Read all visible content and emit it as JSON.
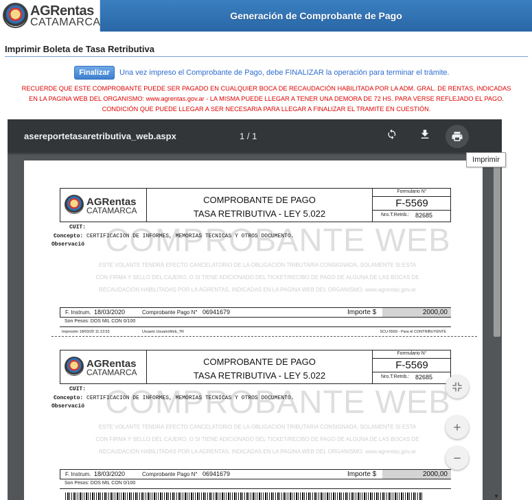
{
  "header": {
    "logo_line1": "AGRentas",
    "logo_line2": "CATAMARCA",
    "title": "Generación de Comprobante de Pago"
  },
  "section": {
    "title": "Imprimir Boleta de Tasa Retributiva"
  },
  "finalize": {
    "button_label": "Finalizar",
    "message": "Una vez impreso el Comprobante de Pago, debe FINALIZAR la operación para terminar el trámite."
  },
  "warning": {
    "lines": [
      "RECUERDE QUE ESTE COMPROBANTE PUEDE SER PAGADO EN CUALQUIER BOCA DE RECAUDACIÓN HABILITADA POR LA ADM. GRAL. DE RENTAS, INDICADAS",
      "EN LA PAGINA WEB DEL ORGANISMO: www.agrentas.gov.ar - LA MISMA PUEDE LLEGAR A TENER UNA DEMORA DE 72 HS. PARA VERSE REFLEJADO EL PAGO.",
      "CONDICIÓN QUE PUEDE LLEGAR A SER NECESARIA PARA LLEGAR A FINALIZAR EL TRAMITE EN CUESTIÓN."
    ]
  },
  "viewer": {
    "filename": "asereportetasaretributiva_web.aspx",
    "page_indicator": "1 / 1",
    "rotate_icon": "rotate-icon",
    "download_icon": "download-icon",
    "print_icon": "print-icon",
    "tooltip": "Imprimir",
    "zoom_fit_icon": "fit-icon",
    "zoom_in_icon": "plus-icon",
    "zoom_out_icon": "minus-icon"
  },
  "receipt": {
    "logo_line1": "AGRentas",
    "logo_line2": "CATAMARCA",
    "title1": "COMPROBANTE DE PAGO",
    "title2": "TASA RETRIBUTIVA - LEY 5.022",
    "form_label": "Formulario N°",
    "form_number": "F-5569",
    "nro_label": "Nro.T.Retrib.:",
    "nro_value": "82685",
    "cuit_label": "CUIT:",
    "concepto_label": "Concepto:",
    "concepto_value": "CERTIFICACION DE INFORMES, MEMORIAS TECNICAS Y OTROS DOCUMENTO.",
    "observacion_label": "Observació",
    "watermark": "COMPROBANTE WEB",
    "legal_lines": [
      "ESTE VOLANTE TENDRÁ EFECTO CANCELATORIO DE LA OBLIGACIÓN TRIBUTARIA CONSIGNADA, SOLAMENTE SI ESTA",
      "CON FIRMA Y SELLO DEL CAJERO, O SI TIENE ADICIONADO DEL TICKET/RECIBO DE PAGO DE ALGUNA DE LAS BOCAS DE",
      "RECAUDACIÓN HABILITADAS POR LA AGRENTAS, INDICADAS EN LA PAGINA WEB DEL ORGANISMO: www.agrentas.gov.ar"
    ],
    "f_instrum_label": "F. Instrum.",
    "f_instrum_value": "18/03/2020",
    "cp_label": "Comprobante Pago N°",
    "cp_value": "06941679",
    "importe_label": "Importe $",
    "importe_value": "2000,00",
    "son_pesos": "Son Pesos:  DOS MIL CON 0/100",
    "impresion": "Impresión 18/03/20   11:13:53",
    "usuario": "Usuario  UsuarioWeb_TR",
    "copy_label": "SCU-5569 - Para el CONTRIBUYENTE"
  }
}
